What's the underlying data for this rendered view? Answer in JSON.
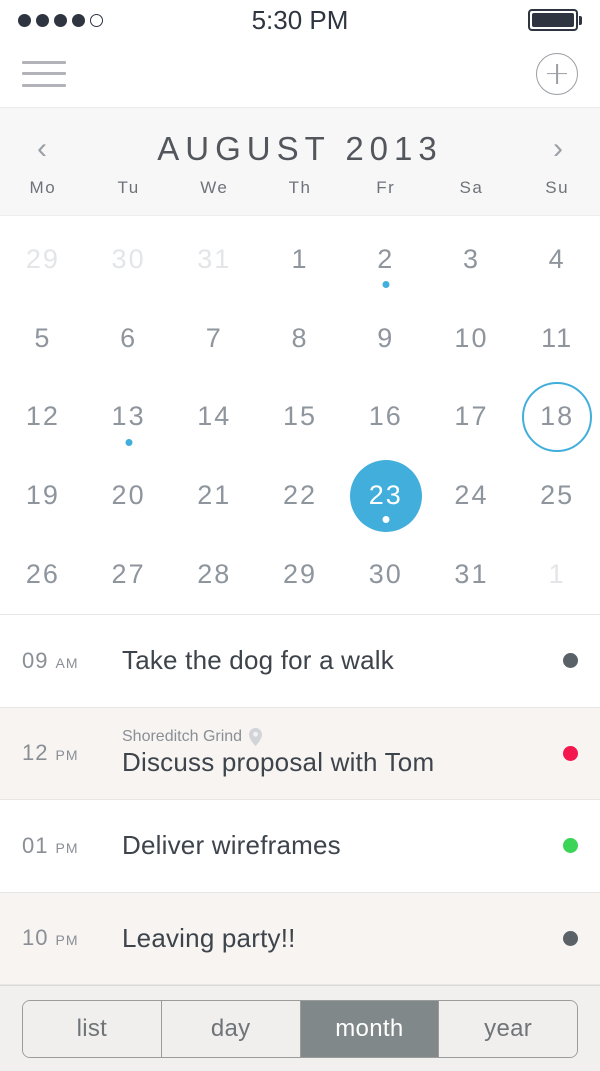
{
  "statusbar": {
    "time": "5:30 PM",
    "signal_dots": [
      "filled",
      "filled",
      "filled",
      "filled",
      "empty"
    ],
    "battery_icon": "battery-full-icon"
  },
  "navbar": {
    "menu_icon": "hamburger-menu-icon",
    "add_icon": "add-plus-circle-icon"
  },
  "month_header": {
    "prev_label": "‹",
    "next_label": "›",
    "title": "AUGUST 2013",
    "weekdays": [
      "Mo",
      "Tu",
      "We",
      "Th",
      "Fr",
      "Sa",
      "Su"
    ]
  },
  "calendar": {
    "accent_color": "#41aedc",
    "weeks": [
      [
        {
          "num": "29",
          "state": "other",
          "dot": false
        },
        {
          "num": "30",
          "state": "other",
          "dot": false
        },
        {
          "num": "31",
          "state": "other",
          "dot": false
        },
        {
          "num": "1",
          "state": "normal",
          "dot": false
        },
        {
          "num": "2",
          "state": "normal",
          "dot": true
        },
        {
          "num": "3",
          "state": "normal",
          "dot": false
        },
        {
          "num": "4",
          "state": "normal",
          "dot": false
        }
      ],
      [
        {
          "num": "5",
          "state": "normal",
          "dot": false
        },
        {
          "num": "6",
          "state": "normal",
          "dot": false
        },
        {
          "num": "7",
          "state": "normal",
          "dot": false
        },
        {
          "num": "8",
          "state": "normal",
          "dot": false
        },
        {
          "num": "9",
          "state": "normal",
          "dot": false
        },
        {
          "num": "10",
          "state": "normal",
          "dot": false
        },
        {
          "num": "11",
          "state": "normal",
          "dot": false
        }
      ],
      [
        {
          "num": "12",
          "state": "normal",
          "dot": false
        },
        {
          "num": "13",
          "state": "normal",
          "dot": true
        },
        {
          "num": "14",
          "state": "normal",
          "dot": false
        },
        {
          "num": "15",
          "state": "normal",
          "dot": false
        },
        {
          "num": "16",
          "state": "normal",
          "dot": false
        },
        {
          "num": "17",
          "state": "normal",
          "dot": false
        },
        {
          "num": "18",
          "state": "today",
          "dot": false
        }
      ],
      [
        {
          "num": "19",
          "state": "normal",
          "dot": false
        },
        {
          "num": "20",
          "state": "normal",
          "dot": false
        },
        {
          "num": "21",
          "state": "normal",
          "dot": false
        },
        {
          "num": "22",
          "state": "normal",
          "dot": false
        },
        {
          "num": "23",
          "state": "selected",
          "dot": true
        },
        {
          "num": "24",
          "state": "normal",
          "dot": false
        },
        {
          "num": "25",
          "state": "normal",
          "dot": false
        }
      ],
      [
        {
          "num": "26",
          "state": "normal",
          "dot": false
        },
        {
          "num": "27",
          "state": "normal",
          "dot": false
        },
        {
          "num": "28",
          "state": "normal",
          "dot": false
        },
        {
          "num": "29",
          "state": "normal",
          "dot": false
        },
        {
          "num": "30",
          "state": "normal",
          "dot": false
        },
        {
          "num": "31",
          "state": "normal",
          "dot": false
        },
        {
          "num": "1",
          "state": "other",
          "dot": false
        }
      ]
    ]
  },
  "events": [
    {
      "hour": "09",
      "ampm": "AM",
      "location": null,
      "title": "Take the dog for a walk",
      "dot_color": "#5a6268",
      "tinted": false
    },
    {
      "hour": "12",
      "ampm": "PM",
      "location": "Shoreditch Grind",
      "title": "Discuss proposal with Tom",
      "dot_color": "#f4184e",
      "tinted": true
    },
    {
      "hour": "01",
      "ampm": "PM",
      "location": null,
      "title": "Deliver wireframes",
      "dot_color": "#3cd457",
      "tinted": false
    },
    {
      "hour": "10",
      "ampm": "PM",
      "location": null,
      "title": "Leaving party!!",
      "dot_color": "#5a6268",
      "tinted": true
    }
  ],
  "footer": {
    "segments": [
      {
        "label": "list",
        "active": false
      },
      {
        "label": "day",
        "active": false
      },
      {
        "label": "month",
        "active": true
      },
      {
        "label": "year",
        "active": false
      }
    ]
  }
}
